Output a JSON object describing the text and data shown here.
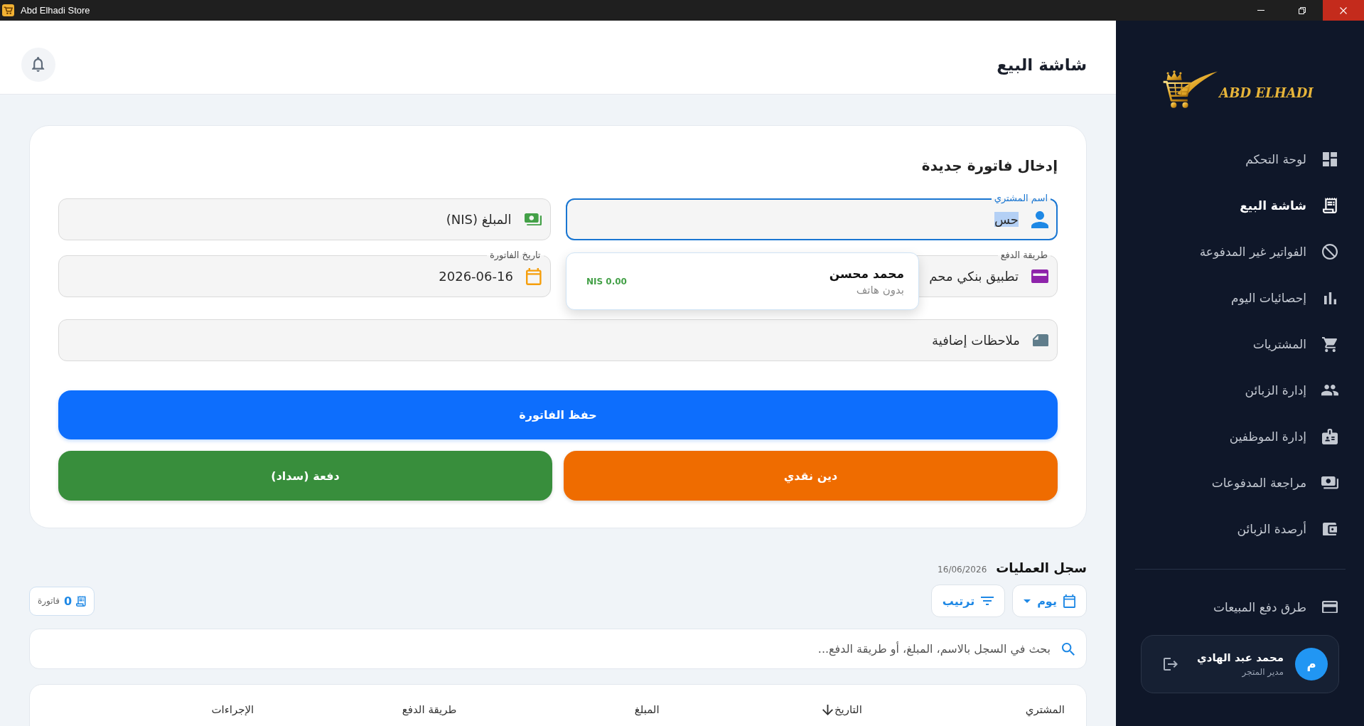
{
  "window": {
    "title": "Abd Elhadi Store"
  },
  "header": {
    "title": "شاشة البيع"
  },
  "sidebar": {
    "logo_text": "ABD ELHADI",
    "items": [
      {
        "label": "لوحة التحكم",
        "selected": false
      },
      {
        "label": "شاشة البيع",
        "selected": true
      },
      {
        "label": "الفواتير غير المدفوعة",
        "selected": false
      },
      {
        "label": "إحصائيات اليوم",
        "selected": false
      },
      {
        "label": "المشتريات",
        "selected": false
      },
      {
        "label": "إدارة الزبائن",
        "selected": false
      },
      {
        "label": "إدارة الموظفين",
        "selected": false
      },
      {
        "label": "مراجعة المدفوعات",
        "selected": false
      },
      {
        "label": "أرصدة الزبائن",
        "selected": false
      }
    ],
    "footer_items": [
      {
        "label": "طرق دفع المبيعات",
        "selected": false
      }
    ],
    "user": {
      "avatar_initial": "م",
      "name": "محمد عبد الهادي",
      "role": "مدير المتجر"
    }
  },
  "invoice_form": {
    "title": "إدخال فاتورة جديدة",
    "fields": [
      {
        "label": "اسم المشتري",
        "value": "حس",
        "focused": true,
        "text_selected": true
      },
      {
        "placeholder": "المبلغ (NIS)",
        "focused": false,
        "text_selected": false
      },
      {
        "label": "طريقة الدفع",
        "value": "تطبيق بنكي محم",
        "focused": false,
        "text_selected": false
      },
      {
        "label": "تاريخ الفاتورة",
        "value": "2026-06-16",
        "focused": false,
        "text_selected": false
      }
    ],
    "notes_field": {
      "placeholder": "ملاحظات إضافية"
    },
    "suggestions": [
      {
        "name": "محمد محسن",
        "phone": "بدون هاتف",
        "balance": "NIS 0.00"
      }
    ],
    "save_button": "حفظ الفاتورة",
    "actions": [
      {
        "label": "دين نقدي",
        "kind": "debt"
      },
      {
        "label": "دفعة (سداد)",
        "kind": "payment"
      }
    ]
  },
  "log": {
    "title": "سجل العمليات",
    "date": "16/06/2026",
    "period_filter": "يوم",
    "sort_button": "ترتيب",
    "invoice_count": {
      "value": "0",
      "label": "فاتورة"
    },
    "search": {
      "placeholder": "بحث في السجل بالاسم، المبلغ، أو طريقة الدفع..."
    },
    "table": {
      "columns": [
        {
          "label": "المشتري",
          "sorted": false
        },
        {
          "label": "التاريخ",
          "sorted": true
        },
        {
          "label": "المبلغ",
          "sorted": false
        },
        {
          "label": "طريقة الدفع",
          "sorted": false
        },
        {
          "label": "الإجراءات",
          "sorted": false
        }
      ]
    }
  }
}
